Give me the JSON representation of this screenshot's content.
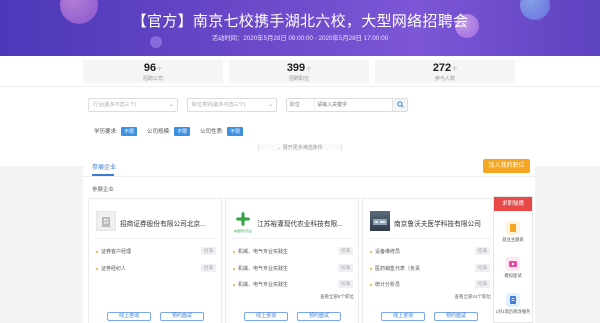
{
  "banner": {
    "title": "【官方】南京七校携手湖北六校，大型网络招聘会",
    "time": "活动时间：2020年5月28日 09:00:00 - 2020年5月28日 17:00:00"
  },
  "stats": [
    {
      "value": "96",
      "unit": "个",
      "label": "招聘公司"
    },
    {
      "value": "399",
      "unit": "个",
      "label": "招聘职位"
    },
    {
      "value": "272",
      "unit": "个",
      "label": "参与人数"
    }
  ],
  "filters": {
    "industry_placeholder": "行业(最多可选三个)",
    "job_placeholder": "职位类别(最多可选三个)",
    "search_type": "职位",
    "search_placeholder": "请输入关键字",
    "education_label": "学历要求:",
    "education_value": "不限",
    "scale_label": "公司规模:",
    "scale_value": "不限",
    "nature_label": "公司性质:",
    "nature_value": "不限",
    "more_label": "展开更多筛选条件"
  },
  "main": {
    "tab": "参展企业",
    "join_button": "加入我的职位",
    "section_title": "参展企业"
  },
  "companies": [
    {
      "name": "招商证券股份有限公司北京...",
      "jobs": [
        {
          "title": "证券客户经理",
          "tag": "招满"
        },
        {
          "title": "证券经纪人",
          "tag": "招满"
        }
      ],
      "extra": "",
      "btn1": "线上咨询",
      "btn2": "预约面试"
    },
    {
      "name": "江苏裕灌现代农业科技有限...",
      "logo_caption": "裕灌现代农业",
      "jobs": [
        {
          "title": "机械、电气专业实践生",
          "tag": "招满"
        },
        {
          "title": "机械、电气专业实践生",
          "tag": "招满"
        },
        {
          "title": "机械、电气专业实践生",
          "tag": "招满"
        }
      ],
      "extra": "查看全部8个职位",
      "btn1": "线上咨询",
      "btn2": "预约面试"
    },
    {
      "name": "南京鲁沃夫医学科技有限公司",
      "jobs": [
        {
          "title": "设备维修员",
          "tag": "招满"
        },
        {
          "title": "医药销售代表（负责",
          "tag": "招满"
        },
        {
          "title": "统计分析员",
          "tag": "招满"
        }
      ],
      "extra": "查看全部24个职位",
      "btn1": "线上咨询",
      "btn2": "预约面试"
    }
  ],
  "sidebar": {
    "title": "求职秘籍",
    "items": [
      {
        "label": "就业主题班",
        "icon": "book-icon"
      },
      {
        "label": "模拟面试",
        "icon": "video-icon"
      },
      {
        "label": "1对1简历修改服务",
        "icon": "resume-icon"
      }
    ]
  }
}
